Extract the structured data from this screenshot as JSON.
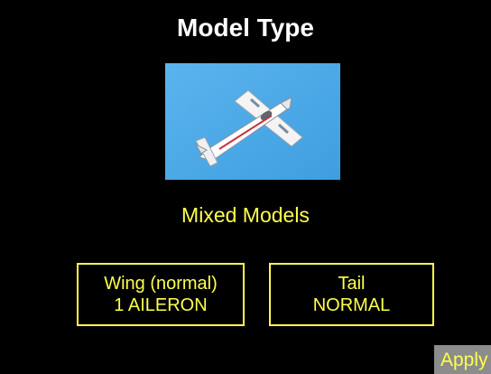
{
  "screen": {
    "title": "Model Type",
    "subtitle": "Mixed Models"
  },
  "model_image": {
    "icon": "airplane-photo",
    "sky_color": "#4aa8e6"
  },
  "options": {
    "wing": {
      "label": "Wing (normal)",
      "value": "1 AILERON"
    },
    "tail": {
      "label": "Tail",
      "value": "NORMAL"
    }
  },
  "actions": {
    "apply_label": "Apply"
  },
  "colors": {
    "background": "#000000",
    "title": "#ffffff",
    "accent": "#ffff4d",
    "apply_bg": "#8c8c8c"
  }
}
